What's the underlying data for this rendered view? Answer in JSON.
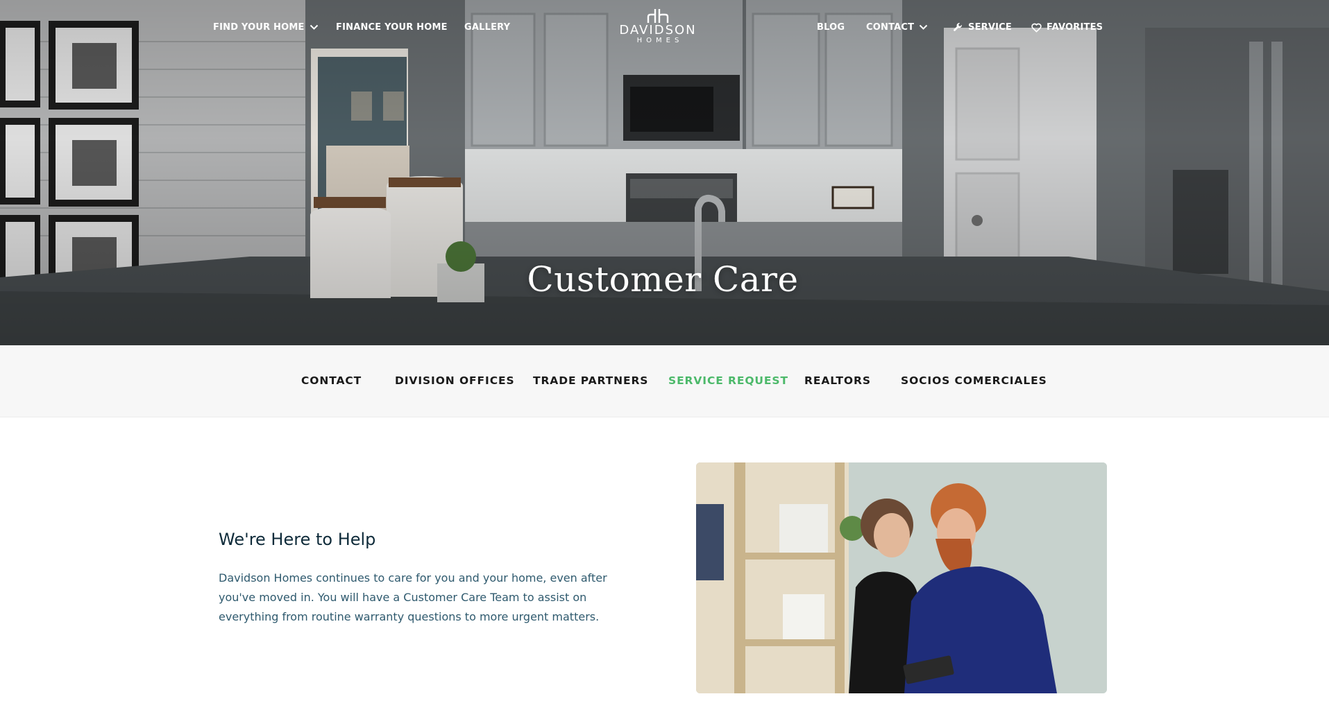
{
  "nav": {
    "left": [
      {
        "label": "FIND YOUR HOME",
        "dropdown": true
      },
      {
        "label": "FINANCE YOUR HOME",
        "dropdown": false
      },
      {
        "label": "GALLERY",
        "dropdown": false
      }
    ],
    "right": [
      {
        "label": "BLOG",
        "icon": ""
      },
      {
        "label": "CONTACT",
        "icon": "chevron-down-icon"
      },
      {
        "label": "SERVICE",
        "icon": "wrench-icon"
      },
      {
        "label": "FAVORITES",
        "icon": "heart-icon"
      }
    ]
  },
  "logo": {
    "word": "DAVIDSON",
    "sub": "HOMES"
  },
  "hero": {
    "title": "Customer Care"
  },
  "subnav": {
    "items": [
      {
        "label": "CONTACT",
        "active": false
      },
      {
        "label": "DIVISION OFFICES",
        "active": false
      },
      {
        "label": "TRADE PARTNERS",
        "active": false
      },
      {
        "label": "SERVICE REQUEST",
        "active": true
      },
      {
        "label": "REALTORS",
        "active": false
      },
      {
        "label": "SOCIOS COMERCIALES",
        "active": false
      }
    ]
  },
  "content": {
    "heading": "We're Here to Help",
    "body": "Davidson Homes continues to care for you and your home, even after you've moved in. You will have a Customer Care Team to assist on everything from routine warranty questions to more urgent matters."
  },
  "colors": {
    "accent_green": "#4cb96a",
    "heading_navy": "#0f2b3a",
    "body_teal": "#2f5a6e",
    "subnav_bg": "#f7f7f7"
  }
}
